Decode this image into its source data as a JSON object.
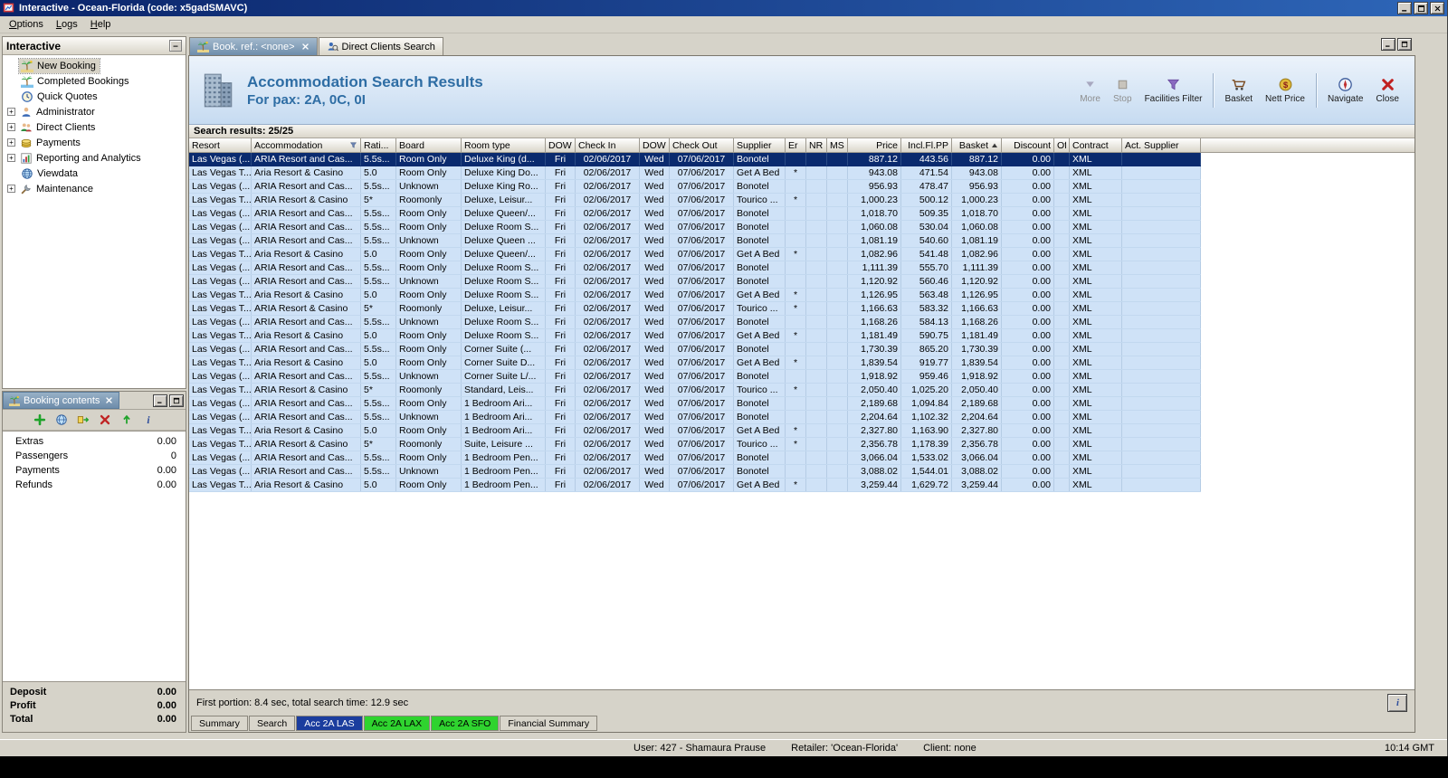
{
  "window": {
    "title": "Interactive - Ocean-Florida (code: x5gadSMAVC)",
    "menu": [
      "Options",
      "Logs",
      "Help"
    ],
    "controls": [
      "minimize",
      "maximize",
      "close"
    ]
  },
  "sidebar": {
    "title": "Interactive",
    "items": [
      {
        "label": "New Booking",
        "icon": "palm-icon",
        "selected": true,
        "expandable": false
      },
      {
        "label": "Completed Bookings",
        "icon": "completed-icon",
        "selected": false,
        "expandable": false
      },
      {
        "label": "Quick Quotes",
        "icon": "quotes-icon",
        "selected": false,
        "expandable": false
      },
      {
        "label": "Administrator",
        "icon": "admin-icon",
        "selected": false,
        "expandable": true
      },
      {
        "label": "Direct Clients",
        "icon": "clients-icon",
        "selected": false,
        "expandable": true
      },
      {
        "label": "Payments",
        "icon": "payments-icon",
        "selected": false,
        "expandable": true
      },
      {
        "label": "Reporting and Analytics",
        "icon": "reporting-icon",
        "selected": false,
        "expandable": true
      },
      {
        "label": "Viewdata",
        "icon": "viewdata-icon",
        "selected": false,
        "expandable": false
      },
      {
        "label": "Maintenance",
        "icon": "maintenance-icon",
        "selected": false,
        "expandable": true
      }
    ]
  },
  "booking_contents": {
    "title": "Booking contents",
    "toolbar_icons": [
      "plus-icon",
      "globe-icon",
      "transfer-icon",
      "delete-icon",
      "up-icon",
      "info-small-icon"
    ],
    "rows": [
      {
        "label": "Extras",
        "value": "0.00"
      },
      {
        "label": "Passengers",
        "value": "0"
      },
      {
        "label": "Payments",
        "value": "0.00"
      },
      {
        "label": "Refunds",
        "value": "0.00"
      }
    ],
    "totals": [
      {
        "label": "Deposit",
        "value": "0.00"
      },
      {
        "label": "Profit",
        "value": "0.00"
      },
      {
        "label": "Total",
        "value": "0.00"
      }
    ]
  },
  "doc_tabs": [
    {
      "label": "Book. ref.: <none>",
      "icon": "palm-icon",
      "active": true,
      "closable": true
    },
    {
      "label": "Direct Clients Search",
      "icon": "search-person-icon",
      "active": false,
      "closable": false
    }
  ],
  "results_header": {
    "title": "Accommodation Search Results",
    "subtitle": "For pax: 2A, 0C, 0I",
    "buttons": [
      {
        "label": "More",
        "icon": "more-icon",
        "disabled": true
      },
      {
        "label": "Stop",
        "icon": "stop-icon",
        "disabled": true
      },
      {
        "label": "Facilities Filter",
        "icon": "filter-icon",
        "disabled": false
      },
      {
        "sep": true
      },
      {
        "label": "Basket",
        "icon": "basket-icon",
        "disabled": false
      },
      {
        "label": "Nett Price",
        "icon": "nett-price-icon",
        "disabled": false
      },
      {
        "sep": true
      },
      {
        "label": "Navigate",
        "icon": "navigate-icon",
        "disabled": false
      },
      {
        "label": "Close",
        "icon": "close-red-icon",
        "disabled": false
      }
    ]
  },
  "results_table": {
    "summary": "Search results: 25/25",
    "filter_column": "Accommodation",
    "sort_column": "Basket",
    "selected_row_index": 0,
    "columns": [
      "Resort",
      "Accommodation",
      "Rati...",
      "Board",
      "Room type",
      "DOW",
      "Check In",
      "DOW",
      "Check Out",
      "Supplier",
      "Er",
      "NR",
      "MS",
      "Price",
      "Incl.Fl.PP",
      "Basket",
      "Discount",
      "Of",
      "Contract",
      "Act. Supplier"
    ],
    "rows": [
      [
        "Las Vegas (...",
        "ARIA Resort and Cas...",
        "5.5s...",
        "Room Only",
        "Deluxe King (d...",
        "Fri",
        "02/06/2017",
        "Wed",
        "07/06/2017",
        "Bonotel",
        "",
        "",
        "",
        "887.12",
        "443.56",
        "887.12",
        "0.00",
        "",
        "XML",
        ""
      ],
      [
        "Las Vegas T...",
        "Aria Resort & Casino",
        "5.0",
        "Room Only",
        "Deluxe King Do...",
        "Fri",
        "02/06/2017",
        "Wed",
        "07/06/2017",
        "Get A Bed",
        "*",
        "",
        "",
        "943.08",
        "471.54",
        "943.08",
        "0.00",
        "",
        "XML",
        ""
      ],
      [
        "Las Vegas (...",
        "ARIA Resort and Cas...",
        "5.5s...",
        "Unknown",
        "Deluxe King Ro...",
        "Fri",
        "02/06/2017",
        "Wed",
        "07/06/2017",
        "Bonotel",
        "",
        "",
        "",
        "956.93",
        "478.47",
        "956.93",
        "0.00",
        "",
        "XML",
        ""
      ],
      [
        "Las Vegas T...",
        "ARIA Resort & Casino",
        "5*",
        "Roomonly",
        "Deluxe, Leisur...",
        "Fri",
        "02/06/2017",
        "Wed",
        "07/06/2017",
        "Tourico ...",
        "*",
        "",
        "",
        "1,000.23",
        "500.12",
        "1,000.23",
        "0.00",
        "",
        "XML",
        ""
      ],
      [
        "Las Vegas (...",
        "ARIA Resort and Cas...",
        "5.5s...",
        "Room Only",
        "Deluxe Queen/...",
        "Fri",
        "02/06/2017",
        "Wed",
        "07/06/2017",
        "Bonotel",
        "",
        "",
        "",
        "1,018.70",
        "509.35",
        "1,018.70",
        "0.00",
        "",
        "XML",
        ""
      ],
      [
        "Las Vegas (...",
        "ARIA Resort and Cas...",
        "5.5s...",
        "Room Only",
        "Deluxe Room S...",
        "Fri",
        "02/06/2017",
        "Wed",
        "07/06/2017",
        "Bonotel",
        "",
        "",
        "",
        "1,060.08",
        "530.04",
        "1,060.08",
        "0.00",
        "",
        "XML",
        ""
      ],
      [
        "Las Vegas (...",
        "ARIA Resort and Cas...",
        "5.5s...",
        "Unknown",
        "Deluxe Queen ...",
        "Fri",
        "02/06/2017",
        "Wed",
        "07/06/2017",
        "Bonotel",
        "",
        "",
        "",
        "1,081.19",
        "540.60",
        "1,081.19",
        "0.00",
        "",
        "XML",
        ""
      ],
      [
        "Las Vegas T...",
        "Aria Resort & Casino",
        "5.0",
        "Room Only",
        "Deluxe Queen/...",
        "Fri",
        "02/06/2017",
        "Wed",
        "07/06/2017",
        "Get A Bed",
        "*",
        "",
        "",
        "1,082.96",
        "541.48",
        "1,082.96",
        "0.00",
        "",
        "XML",
        ""
      ],
      [
        "Las Vegas (...",
        "ARIA Resort and Cas...",
        "5.5s...",
        "Room Only",
        "Deluxe Room S...",
        "Fri",
        "02/06/2017",
        "Wed",
        "07/06/2017",
        "Bonotel",
        "",
        "",
        "",
        "1,111.39",
        "555.70",
        "1,111.39",
        "0.00",
        "",
        "XML",
        ""
      ],
      [
        "Las Vegas (...",
        "ARIA Resort and Cas...",
        "5.5s...",
        "Unknown",
        "Deluxe Room S...",
        "Fri",
        "02/06/2017",
        "Wed",
        "07/06/2017",
        "Bonotel",
        "",
        "",
        "",
        "1,120.92",
        "560.46",
        "1,120.92",
        "0.00",
        "",
        "XML",
        ""
      ],
      [
        "Las Vegas T...",
        "Aria Resort & Casino",
        "5.0",
        "Room Only",
        "Deluxe Room S...",
        "Fri",
        "02/06/2017",
        "Wed",
        "07/06/2017",
        "Get A Bed",
        "*",
        "",
        "",
        "1,126.95",
        "563.48",
        "1,126.95",
        "0.00",
        "",
        "XML",
        ""
      ],
      [
        "Las Vegas T...",
        "ARIA Resort & Casino",
        "5*",
        "Roomonly",
        "Deluxe, Leisur...",
        "Fri",
        "02/06/2017",
        "Wed",
        "07/06/2017",
        "Tourico ...",
        "*",
        "",
        "",
        "1,166.63",
        "583.32",
        "1,166.63",
        "0.00",
        "",
        "XML",
        ""
      ],
      [
        "Las Vegas (...",
        "ARIA Resort and Cas...",
        "5.5s...",
        "Unknown",
        "Deluxe Room S...",
        "Fri",
        "02/06/2017",
        "Wed",
        "07/06/2017",
        "Bonotel",
        "",
        "",
        "",
        "1,168.26",
        "584.13",
        "1,168.26",
        "0.00",
        "",
        "XML",
        ""
      ],
      [
        "Las Vegas T...",
        "Aria Resort & Casino",
        "5.0",
        "Room Only",
        "Deluxe Room S...",
        "Fri",
        "02/06/2017",
        "Wed",
        "07/06/2017",
        "Get A Bed",
        "*",
        "",
        "",
        "1,181.49",
        "590.75",
        "1,181.49",
        "0.00",
        "",
        "XML",
        ""
      ],
      [
        "Las Vegas (...",
        "ARIA Resort and Cas...",
        "5.5s...",
        "Room Only",
        "Corner Suite (...",
        "Fri",
        "02/06/2017",
        "Wed",
        "07/06/2017",
        "Bonotel",
        "",
        "",
        "",
        "1,730.39",
        "865.20",
        "1,730.39",
        "0.00",
        "",
        "XML",
        ""
      ],
      [
        "Las Vegas T...",
        "Aria Resort & Casino",
        "5.0",
        "Room Only",
        "Corner Suite D...",
        "Fri",
        "02/06/2017",
        "Wed",
        "07/06/2017",
        "Get A Bed",
        "*",
        "",
        "",
        "1,839.54",
        "919.77",
        "1,839.54",
        "0.00",
        "",
        "XML",
        ""
      ],
      [
        "Las Vegas (...",
        "ARIA Resort and Cas...",
        "5.5s...",
        "Unknown",
        "Corner Suite L/...",
        "Fri",
        "02/06/2017",
        "Wed",
        "07/06/2017",
        "Bonotel",
        "",
        "",
        "",
        "1,918.92",
        "959.46",
        "1,918.92",
        "0.00",
        "",
        "XML",
        ""
      ],
      [
        "Las Vegas T...",
        "ARIA Resort & Casino",
        "5*",
        "Roomonly",
        "Standard, Leis...",
        "Fri",
        "02/06/2017",
        "Wed",
        "07/06/2017",
        "Tourico ...",
        "*",
        "",
        "",
        "2,050.40",
        "1,025.20",
        "2,050.40",
        "0.00",
        "",
        "XML",
        ""
      ],
      [
        "Las Vegas (...",
        "ARIA Resort and Cas...",
        "5.5s...",
        "Room Only",
        "1 Bedroom Ari...",
        "Fri",
        "02/06/2017",
        "Wed",
        "07/06/2017",
        "Bonotel",
        "",
        "",
        "",
        "2,189.68",
        "1,094.84",
        "2,189.68",
        "0.00",
        "",
        "XML",
        ""
      ],
      [
        "Las Vegas (...",
        "ARIA Resort and Cas...",
        "5.5s...",
        "Unknown",
        "1 Bedroom Ari...",
        "Fri",
        "02/06/2017",
        "Wed",
        "07/06/2017",
        "Bonotel",
        "",
        "",
        "",
        "2,204.64",
        "1,102.32",
        "2,204.64",
        "0.00",
        "",
        "XML",
        ""
      ],
      [
        "Las Vegas T...",
        "Aria Resort & Casino",
        "5.0",
        "Room Only",
        "1 Bedroom Ari...",
        "Fri",
        "02/06/2017",
        "Wed",
        "07/06/2017",
        "Get A Bed",
        "*",
        "",
        "",
        "2,327.80",
        "1,163.90",
        "2,327.80",
        "0.00",
        "",
        "XML",
        ""
      ],
      [
        "Las Vegas T...",
        "ARIA Resort & Casino",
        "5*",
        "Roomonly",
        "Suite, Leisure ...",
        "Fri",
        "02/06/2017",
        "Wed",
        "07/06/2017",
        "Tourico ...",
        "*",
        "",
        "",
        "2,356.78",
        "1,178.39",
        "2,356.78",
        "0.00",
        "",
        "XML",
        ""
      ],
      [
        "Las Vegas (...",
        "ARIA Resort and Cas...",
        "5.5s...",
        "Room Only",
        "1 Bedroom Pen...",
        "Fri",
        "02/06/2017",
        "Wed",
        "07/06/2017",
        "Bonotel",
        "",
        "",
        "",
        "3,066.04",
        "1,533.02",
        "3,066.04",
        "0.00",
        "",
        "XML",
        ""
      ],
      [
        "Las Vegas (...",
        "ARIA Resort and Cas...",
        "5.5s...",
        "Unknown",
        "1 Bedroom Pen...",
        "Fri",
        "02/06/2017",
        "Wed",
        "07/06/2017",
        "Bonotel",
        "",
        "",
        "",
        "3,088.02",
        "1,544.01",
        "3,088.02",
        "0.00",
        "",
        "XML",
        ""
      ],
      [
        "Las Vegas T...",
        "Aria Resort & Casino",
        "5.0",
        "Room Only",
        "1 Bedroom Pen...",
        "Fri",
        "02/06/2017",
        "Wed",
        "07/06/2017",
        "Get A Bed",
        "*",
        "",
        "",
        "3,259.44",
        "1,629.72",
        "3,259.44",
        "0.00",
        "",
        "XML",
        ""
      ]
    ]
  },
  "search_status": {
    "text": "First portion: 8.4 sec, total search time: 12.9 sec"
  },
  "bottom_tabs": [
    {
      "label": "Summary",
      "style": "normal"
    },
    {
      "label": "Search",
      "style": "normal"
    },
    {
      "label": "Acc 2A LAS",
      "style": "blue"
    },
    {
      "label": "Acc 2A LAX",
      "style": "green"
    },
    {
      "label": "Acc 2A SFO",
      "style": "green"
    },
    {
      "label": "Financial Summary",
      "style": "normal"
    }
  ],
  "statusbar": {
    "user": "User: 427 - Shamaura Prause",
    "retailer": "Retailer: 'Ocean-Florida'",
    "client": "Client: none",
    "time": "10:14 GMT"
  },
  "colors": {
    "titlebar": "#0a246a",
    "selection": "#0a2a6e",
    "row_bg": "#cfe2f7",
    "header_text": "#2e6da4",
    "tab_blue": "#1b3d9e",
    "tab_green": "#2fd32f"
  }
}
